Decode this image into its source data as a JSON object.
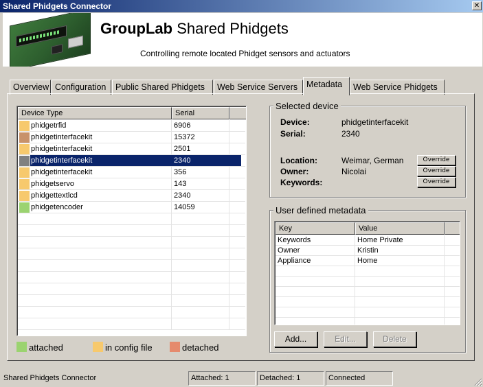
{
  "window": {
    "title": "Shared Phidgets Connector",
    "close_glyph": "✕"
  },
  "banner": {
    "title_bold": "GroupLab",
    "title_rest": " Shared Phidgets",
    "subtitle": "Controlling remote located Phidget sensors and actuators"
  },
  "tabs": [
    {
      "label": "Overview",
      "active": false
    },
    {
      "label": "Configuration",
      "active": false
    },
    {
      "label": "Public Shared Phidgets",
      "active": false
    },
    {
      "label": "Web Service Servers",
      "active": false
    },
    {
      "label": "Metadata",
      "active": true
    },
    {
      "label": "Web Service Phidgets",
      "active": false
    }
  ],
  "devices": {
    "columns": [
      "Device Type",
      "Serial"
    ],
    "rows": [
      {
        "type": "phidgetrfid",
        "serial": "6906",
        "color": "#f7c96d",
        "selected": false
      },
      {
        "type": "phidgetinterfacekit",
        "serial": "15372",
        "color": "#c8926a",
        "selected": false
      },
      {
        "type": "phidgetinterfacekit",
        "serial": "2501",
        "color": "#f7c96d",
        "selected": false
      },
      {
        "type": "phidgetinterfacekit",
        "serial": "2340",
        "color": "#808080",
        "selected": true
      },
      {
        "type": "phidgetinterfacekit",
        "serial": "356",
        "color": "#f7c96d",
        "selected": false
      },
      {
        "type": "phidgetservo",
        "serial": "143",
        "color": "#f7c96d",
        "selected": false
      },
      {
        "type": "phidgettextlcd",
        "serial": "2340",
        "color": "#f7c96d",
        "selected": false
      },
      {
        "type": "phidgetencoder",
        "serial": "14059",
        "color": "#9bd370",
        "selected": false
      }
    ]
  },
  "legend": [
    {
      "label": "attached",
      "color": "#9bd370"
    },
    {
      "label": "in config file",
      "color": "#f7c96d"
    },
    {
      "label": "detached",
      "color": "#e58a6d"
    }
  ],
  "selected_device": {
    "group_title": "Selected device",
    "device_label": "Device:",
    "device_value": "phidgetinterfacekit",
    "serial_label": "Serial:",
    "serial_value": "2340",
    "location_label": "Location:",
    "location_value": "Weimar, German",
    "owner_label": "Owner:",
    "owner_value": "Nicolai",
    "keywords_label": "Keywords:",
    "keywords_value": "",
    "override_label": "Override"
  },
  "user_metadata": {
    "group_title": "User defined metadata",
    "columns": [
      "Key",
      "Value"
    ],
    "rows": [
      {
        "key": "Keywords",
        "value": "Home Private"
      },
      {
        "key": "Owner",
        "value": "Kristin"
      },
      {
        "key": "Appliance",
        "value": "Home"
      }
    ],
    "add_label": "Add...",
    "edit_label": "Edit...",
    "delete_label": "Delete"
  },
  "statusbar": {
    "text": "Shared Phidgets Connector",
    "attached": "Attached: 1",
    "detached": "Detached: 1",
    "connection": "Connected"
  }
}
